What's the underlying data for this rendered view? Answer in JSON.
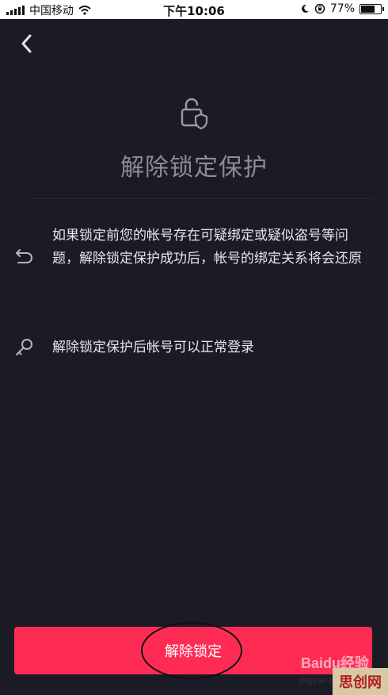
{
  "status_bar": {
    "carrier": "中国移动",
    "time": "下午10:06",
    "battery_percent": "77%",
    "battery_level": 0.77,
    "icons": [
      "signal-icon",
      "wifi-icon",
      "moon-icon",
      "orientation-lock-icon",
      "battery-icon"
    ]
  },
  "header": {
    "back_icon": "chevron-left-icon"
  },
  "lock": {
    "icon": "lock-shield-icon"
  },
  "title": "解除锁定保护",
  "info": [
    {
      "icon": "undo-arrow-icon",
      "text": "如果锁定前您的帐号存在可疑绑定或疑似盗号等问题，解除锁定保护成功后，帐号的绑定关系将会还原"
    },
    {
      "icon": "key-icon",
      "text": "解除锁定保护后帐号可以正常登录"
    }
  ],
  "button": {
    "label": "解除锁定",
    "color": "#fe2c55"
  },
  "watermark": {
    "baidu": "Baidu经验",
    "site": "jingyan.b",
    "corner": "思创网"
  }
}
